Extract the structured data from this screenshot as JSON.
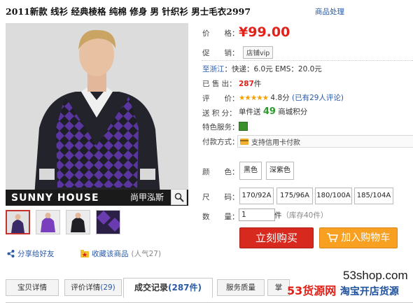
{
  "product": {
    "title": "2011新款 线衫 经典棱格 纯棉 修身 男 针织衫 男士毛衣2997",
    "report_link": "商品处理",
    "brand_en": "SUNNY HOUSE",
    "brand_cn": "尚甲泓斯"
  },
  "info": {
    "price_label": "价　　格：",
    "price": "¥99.00",
    "promo_label": "促　　销：",
    "promo_tag": "店铺vip",
    "ship_from": "至浙江",
    "ship_rest": "：快递：6.0元  EMS：20.0元",
    "sold_label": "已 售 出：",
    "sold_count": "287",
    "sold_unit": "件",
    "rating_label": "评　　价：",
    "rating_stars": "★★★★★",
    "rating_score": "4.8分",
    "rating_reviews": "(已有29人评论)",
    "points_label": "送 积 分：",
    "points_prefix": "单件送",
    "points_value": "49",
    "points_suffix": "商城积分",
    "service_label": "特色服务：",
    "payment_label": "付款方式：",
    "payment_text": "支持信用卡付款"
  },
  "options": {
    "color_label": "颜　　色：",
    "colors": [
      "黑色",
      "深紫色"
    ],
    "size_label": "尺　　码：",
    "sizes": [
      "170/92A",
      "175/96A",
      "180/100A",
      "185/104A"
    ],
    "qty_label": "数　　量：",
    "qty_value": "1",
    "qty_unit": "件",
    "qty_stock": "（库存40件）"
  },
  "actions": {
    "buy_now": "立刻购买",
    "add_cart": "加入购物车",
    "share": "分享给好友",
    "favorite": "收藏该商品",
    "popularity": "(人气27)"
  },
  "tabs": [
    {
      "label": "宝贝详情",
      "count": ""
    },
    {
      "label": "评价详情",
      "count": "(29)"
    },
    {
      "label": "成交记录",
      "count": "(287件)"
    },
    {
      "label": "服务质量",
      "count": ""
    },
    {
      "label": "掌",
      "count": ""
    }
  ],
  "watermark": {
    "top": "53shop.com",
    "bottom_red": "53货源网",
    "bottom_blue": "淘宝开店货源"
  },
  "colors": {
    "price_red": "#e0221a",
    "link_blue": "#2a5aa8",
    "buy_red": "#d8291f",
    "cart_orange": "#f7a021",
    "sweater_purple": "#4b2b8a"
  }
}
